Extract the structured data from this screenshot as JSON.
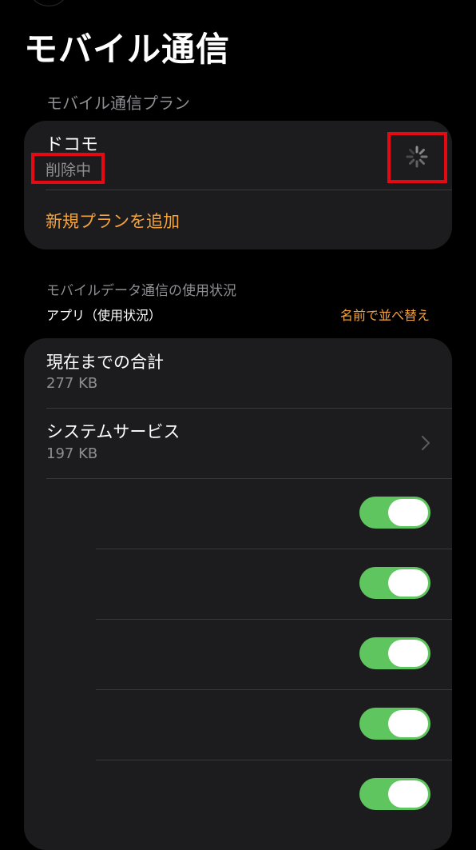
{
  "page": {
    "title": "モバイル通信"
  },
  "plans_section": {
    "header": "モバイル通信プラン",
    "plan": {
      "name": "ドコモ",
      "status": "削除中",
      "loading": true
    },
    "add_plan_label": "新規プランを追加"
  },
  "usage_section": {
    "header": "モバイルデータ通信の使用状況",
    "apps_label": "アプリ（使用状況）",
    "sort_label": "名前で並べ替え",
    "total": {
      "title": "現在までの合計",
      "value": "277 KB"
    },
    "system_services": {
      "title": "システムサービス",
      "value": "197 KB"
    },
    "app_toggles": [
      {
        "enabled": true
      },
      {
        "enabled": true
      },
      {
        "enabled": true
      },
      {
        "enabled": true
      },
      {
        "enabled": true
      }
    ]
  },
  "colors": {
    "background": "#000000",
    "card": "#1c1c1e",
    "accent": "#f4a23b",
    "secondary_text": "#8e8e93",
    "toggle_on": "#5fc55e",
    "highlight": "#e50914"
  },
  "icons": {
    "spinner": "activity-spinner-icon",
    "chevron": "chevron-right-icon"
  }
}
